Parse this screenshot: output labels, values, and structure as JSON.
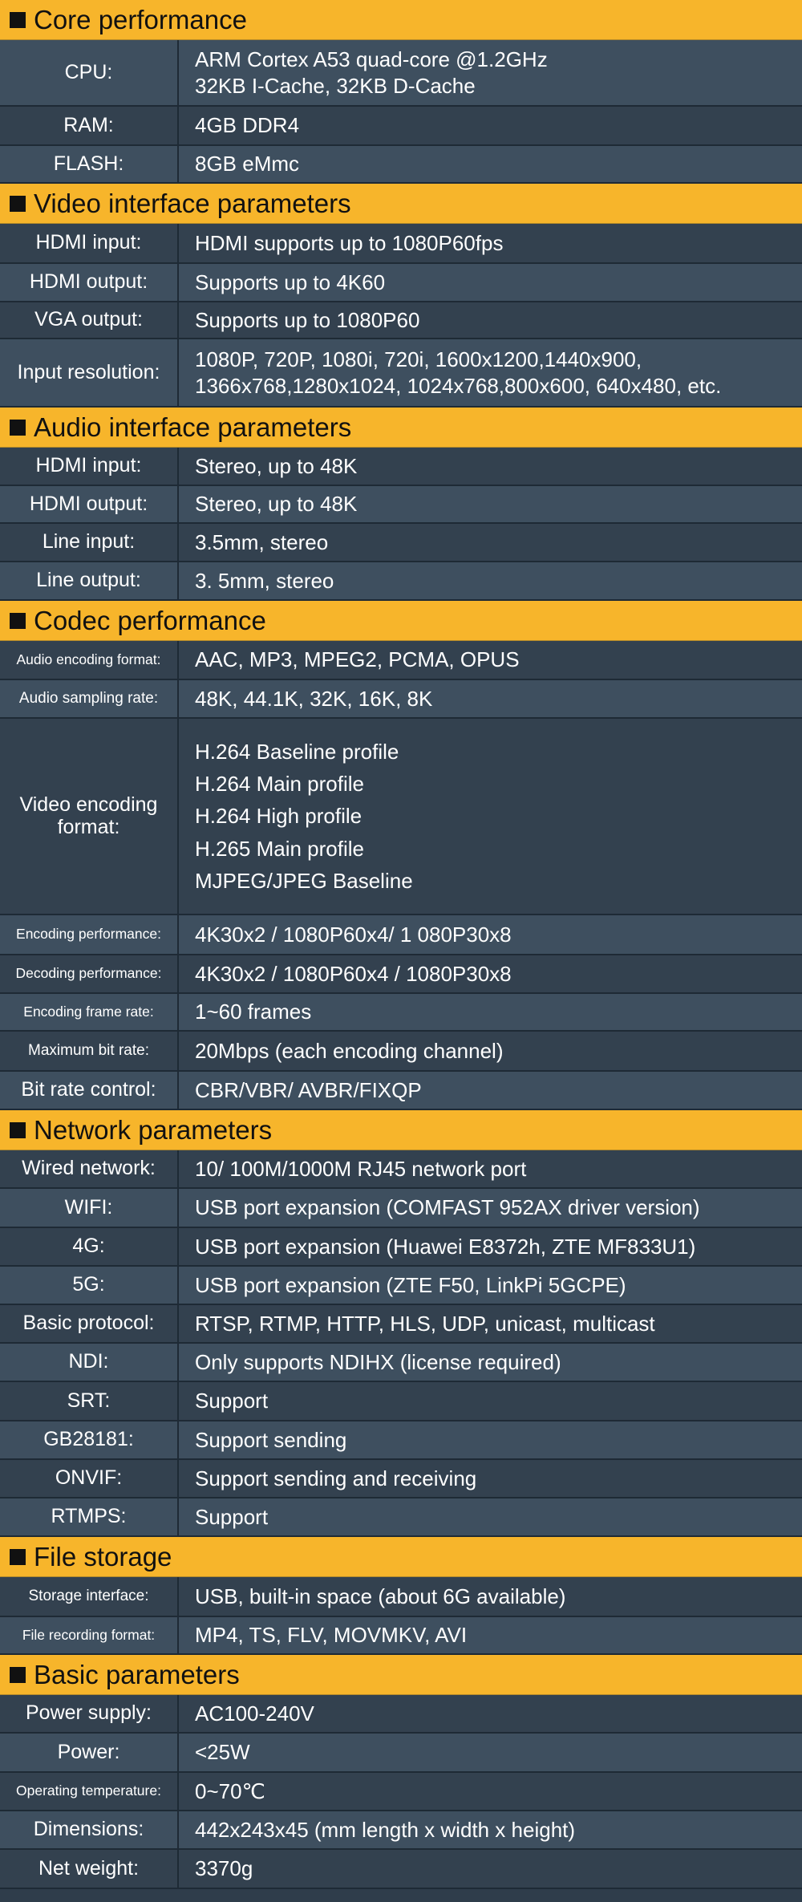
{
  "sections": [
    {
      "title": "Core performance",
      "rows": [
        {
          "label": "CPU:",
          "values": [
            "ARM Cortex A53 quad-core @1.2GHz",
            "32KB I-Cache, 32KB D-Cache"
          ]
        },
        {
          "label": "RAM:",
          "values": [
            "4GB DDR4"
          ]
        },
        {
          "label": "FLASH:",
          "values": [
            "8GB eMmc"
          ]
        }
      ]
    },
    {
      "title": "Video interface parameters",
      "rows": [
        {
          "label": "HDMI input:",
          "values": [
            "HDMI supports up to 1080P60fps"
          ]
        },
        {
          "label": "HDMI output:",
          "values": [
            "Supports up to 4K60"
          ]
        },
        {
          "label": "VGA output:",
          "values": [
            "Supports up to 1080P60"
          ]
        },
        {
          "label": "Input resolution:",
          "values": [
            "1080P, 720P, 1080i, 720i, 1600x1200,1440x900,",
            "1366x768,1280x1024, 1024x768,800x600, 640x480, etc."
          ]
        }
      ]
    },
    {
      "title": "Audio interface parameters",
      "rows": [
        {
          "label": "HDMI input:",
          "values": [
            "Stereo, up to 48K"
          ]
        },
        {
          "label": "HDMI output:",
          "values": [
            "Stereo, up to 48K"
          ]
        },
        {
          "label": "Line input:",
          "values": [
            "3.5mm, stereo"
          ]
        },
        {
          "label": "Line output:",
          "values": [
            "3. 5mm, stereo"
          ]
        }
      ]
    },
    {
      "title": "Codec performance",
      "rows": [
        {
          "label": "Audio encoding format:",
          "values": [
            "AAC, MP3, MPEG2, PCMA, OPUS"
          ]
        },
        {
          "label": "Audio sampling rate:",
          "values": [
            "48K, 44.1K, 32K, 16K, 8K"
          ]
        },
        {
          "label": "Video encoding format:",
          "values": [
            "H.264 Baseline profile",
            "H.264 Main profile",
            "H.264 High profile",
            "H.265 Main profile",
            "MJPEG/JPEG Baseline"
          ]
        },
        {
          "label": "Encoding performance:",
          "values": [
            "4K30x2 / 1080P60x4/ 1 080P30x8"
          ]
        },
        {
          "label": "Decoding performance:",
          "values": [
            "4K30x2 / 1080P60x4 / 1080P30x8"
          ]
        },
        {
          "label": "Encoding frame rate:",
          "values": [
            "1~60 frames"
          ]
        },
        {
          "label": "Maximum bit rate:",
          "values": [
            "20Mbps (each encoding channel)"
          ]
        },
        {
          "label": "Bit rate control:",
          "values": [
            "CBR/VBR/ AVBR/FIXQP"
          ]
        }
      ]
    },
    {
      "title": "Network parameters",
      "rows": [
        {
          "label": "Wired network:",
          "values": [
            "10/ 100M/1000M RJ45 network port"
          ]
        },
        {
          "label": "WIFI:",
          "values": [
            "USB port expansion (COMFAST 952AX driver version)"
          ]
        },
        {
          "label": "4G:",
          "values": [
            "USB port expansion (Huawei E8372h, ZTE MF833U1)"
          ]
        },
        {
          "label": "5G:",
          "values": [
            "USB port expansion (ZTE F50, LinkPi 5GCPE)"
          ]
        },
        {
          "label": "Basic protocol:",
          "values": [
            "RTSP, RTMP, HTTP, HLS, UDP, unicast, multicast"
          ]
        },
        {
          "label": "NDI:",
          "values": [
            "Only supports NDIHX (license required)"
          ]
        },
        {
          "label": "SRT:",
          "values": [
            "Support"
          ]
        },
        {
          "label": "GB28181:",
          "values": [
            "Support sending"
          ]
        },
        {
          "label": "ONVIF:",
          "values": [
            "Support sending and receiving"
          ]
        },
        {
          "label": "RTMPS:",
          "values": [
            "Support"
          ]
        }
      ]
    },
    {
      "title": "File storage",
      "rows": [
        {
          "label": "Storage interface:",
          "values": [
            "USB, built-in space (about 6G available)"
          ]
        },
        {
          "label": "File recording format:",
          "values": [
            "MP4, TS, FLV, MOVMKV, AVI"
          ]
        }
      ]
    },
    {
      "title": "Basic parameters",
      "rows": [
        {
          "label": "Power supply:",
          "values": [
            "AC100-240V"
          ]
        },
        {
          "label": "Power:",
          "values": [
            "<25W"
          ]
        },
        {
          "label": "Operating temperature:",
          "values": [
            "0~70℃"
          ]
        },
        {
          "label": "Dimensions:",
          "values": [
            "442x243x45 (mm length x width x height)"
          ]
        },
        {
          "label": "Net weight:",
          "values": [
            "3370g"
          ]
        }
      ]
    }
  ]
}
